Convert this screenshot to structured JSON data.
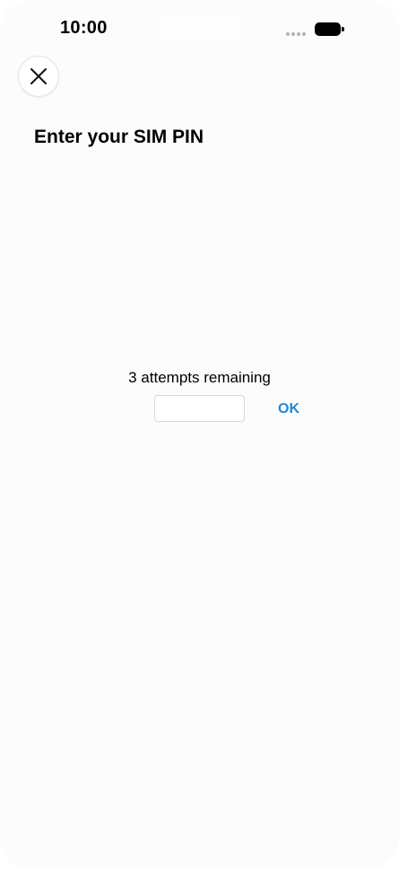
{
  "status_bar": {
    "time": "10:00",
    "signal_icon": "signal-dots-icon",
    "battery_icon": "battery-icon"
  },
  "header": {
    "close_icon": "close-icon",
    "title": "Enter your SIM PIN"
  },
  "pin_form": {
    "attempts_text": "3 attempts remaining",
    "pin_value": "",
    "pin_placeholder": "",
    "ok_label": "OK"
  },
  "colors": {
    "accent": "#1e8ad6",
    "background": "#fcfcfd",
    "text": "#000000"
  }
}
